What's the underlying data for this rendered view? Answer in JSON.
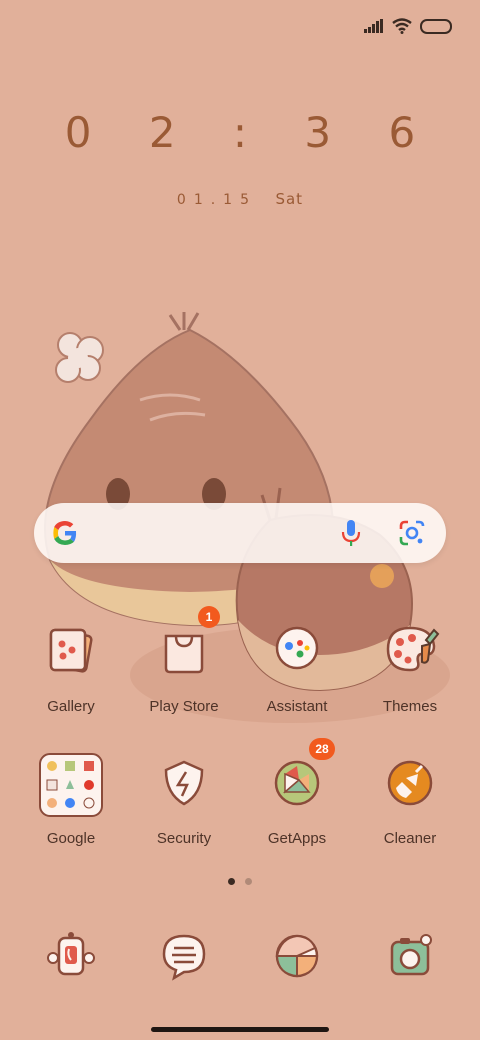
{
  "status_bar": {
    "icons": [
      "signal-icon",
      "wifi-icon",
      "battery-icon"
    ]
  },
  "clock": {
    "time": "0 2 : 3 6",
    "date_numbers": "01.15",
    "day_of_week": "Sat"
  },
  "search_bar": {
    "icons": [
      "google-g-icon",
      "microphone-icon",
      "google-lens-icon"
    ]
  },
  "apps_row1": [
    {
      "label": "Gallery",
      "icon": "gallery-icon"
    },
    {
      "label": "Play Store",
      "icon": "play-store-icon",
      "badge": "1"
    },
    {
      "label": "Assistant",
      "icon": "assistant-icon"
    },
    {
      "label": "Themes",
      "icon": "themes-icon"
    }
  ],
  "apps_row2": [
    {
      "label": "Google",
      "icon": "google-folder-icon"
    },
    {
      "label": "Security",
      "icon": "security-icon"
    },
    {
      "label": "GetApps",
      "icon": "getapps-icon",
      "badge": "28"
    },
    {
      "label": "Cleaner",
      "icon": "cleaner-icon"
    }
  ],
  "page_indicator": {
    "pages": 2,
    "current": 1
  },
  "dock": [
    {
      "icon": "phone-icon"
    },
    {
      "icon": "messages-icon"
    },
    {
      "icon": "browser-icon"
    },
    {
      "icon": "camera-icon"
    }
  ],
  "colors": {
    "background": "#e1b09a",
    "clock": "#9a5a35",
    "badge": "#f25a1e"
  }
}
